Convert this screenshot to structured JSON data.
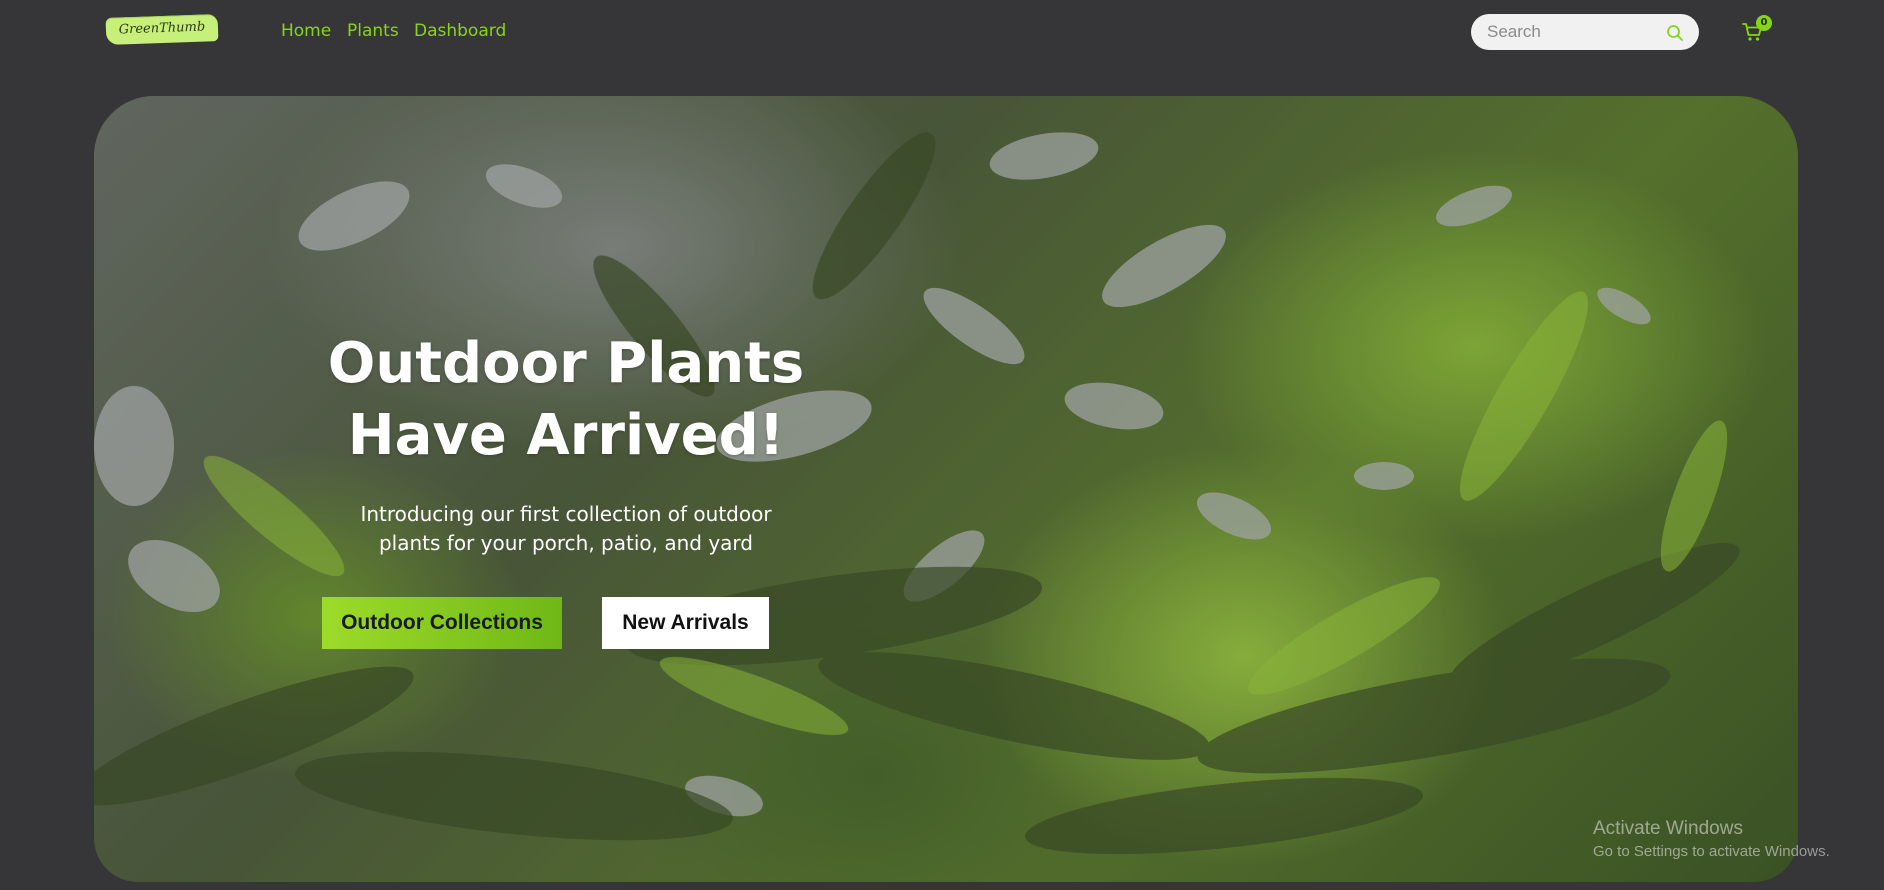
{
  "brand": {
    "logo_text": "GreenThumb"
  },
  "nav": {
    "links": [
      {
        "label": "Home"
      },
      {
        "label": "Plants"
      },
      {
        "label": "Dashboard"
      }
    ]
  },
  "search": {
    "placeholder": "Search",
    "value": "",
    "icon": "search-icon"
  },
  "cart": {
    "icon": "cart-icon",
    "count": "0"
  },
  "hero": {
    "title_line1": "Outdoor Plants",
    "title_line2": "Have Arrived!",
    "subtitle_line1": "Introducing our first collection of outdoor",
    "subtitle_line2": "plants for your porch, patio, and yard",
    "primary_button": "Outdoor Collections",
    "secondary_button": "New Arrivals",
    "background": "foliage-photo"
  },
  "watermark": {
    "title": "Activate Windows",
    "subtitle": "Go to Settings to activate Windows."
  },
  "colors": {
    "accent": "#86d617",
    "page_background": "#363638",
    "primary_button": "#8fd11f",
    "secondary_button": "#ffffff"
  }
}
